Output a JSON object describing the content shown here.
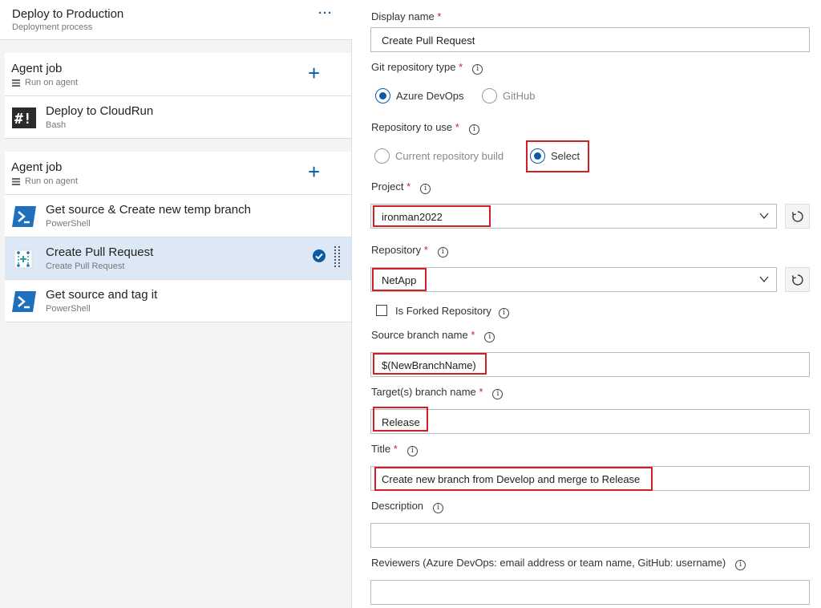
{
  "stage": {
    "title": "Deploy to Production",
    "subtitle": "Deployment process",
    "more_label": "···"
  },
  "jobs": [
    {
      "title": "Agent job",
      "subtitle": "Run on agent",
      "tasks": [
        {
          "title": "Deploy to CloudRun",
          "subtitle": "Bash",
          "icon": "bash-icon",
          "selected": false
        }
      ]
    },
    {
      "title": "Agent job",
      "subtitle": "Run on agent",
      "tasks": [
        {
          "title": "Get source & Create new temp branch",
          "subtitle": "PowerShell",
          "icon": "powershell-icon",
          "selected": false
        },
        {
          "title": "Create Pull Request",
          "subtitle": "Create Pull Request",
          "icon": "pull-request-icon",
          "selected": true
        },
        {
          "title": "Get source and tag it",
          "subtitle": "PowerShell",
          "icon": "powershell-icon",
          "selected": false
        }
      ]
    }
  ],
  "form": {
    "display_name": {
      "label": "Display name",
      "required": "*",
      "value": "Create Pull Request"
    },
    "git_repo_type": {
      "label": "Git repository type",
      "required": "*",
      "options": [
        "Azure DevOps",
        "GitHub"
      ],
      "selected": "Azure DevOps"
    },
    "repo_to_use": {
      "label": "Repository to use",
      "required": "*",
      "options": [
        "Current repository build",
        "Select"
      ],
      "selected": "Select"
    },
    "project": {
      "label": "Project",
      "required": "*",
      "value": "ironman2022"
    },
    "repository": {
      "label": "Repository",
      "required": "*",
      "value": "NetApp"
    },
    "is_forked": {
      "label": "Is Forked Repository",
      "checked": false
    },
    "source_branch": {
      "label": "Source branch name",
      "required": "*",
      "value": "$(NewBranchName)"
    },
    "target_branch": {
      "label": "Target(s) branch name",
      "required": "*",
      "value": "Release"
    },
    "title": {
      "label": "Title",
      "required": "*",
      "value": "Create new branch from Develop and merge to Release"
    },
    "description": {
      "label": "Description",
      "value": ""
    },
    "reviewers": {
      "label": "Reviewers (Azure DevOps: email address or team name, GitHub: username)",
      "value": ""
    }
  },
  "colors": {
    "accent": "#0a5aa6",
    "highlight": "#d21f26",
    "selected_row": "#dce8f5",
    "required": "#c0262d"
  }
}
